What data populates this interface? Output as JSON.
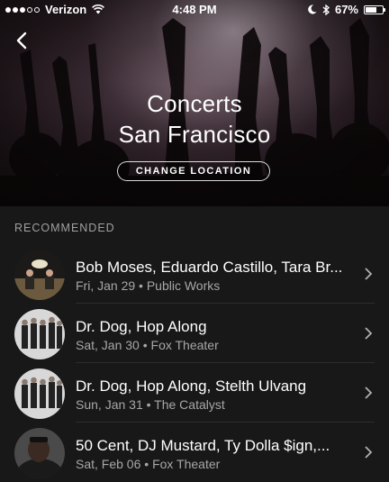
{
  "status_bar": {
    "carrier": "Verizon",
    "time": "4:48 PM",
    "battery": "67%",
    "battery_level": 0.67
  },
  "header": {
    "title_line1": "Concerts",
    "title_line2": "San Francisco",
    "change_location_label": "CHANGE LOCATION"
  },
  "section": {
    "label": "RECOMMENDED"
  },
  "concerts": [
    {
      "artists": "Bob Moses, Eduardo Castillo, Tara Br...",
      "date": "Fri, Jan 29",
      "venue": "Public Works"
    },
    {
      "artists": "Dr. Dog, Hop Along",
      "date": "Sat, Jan 30",
      "venue": "Fox Theater"
    },
    {
      "artists": "Dr. Dog, Hop Along, Stelth Ulvang",
      "date": "Sun, Jan 31",
      "venue": "The Catalyst"
    },
    {
      "artists": "50 Cent, DJ Mustard, Ty Dolla $ign,...",
      "date": "Sat, Feb 06",
      "venue": "Fox Theater"
    }
  ],
  "separator": "•"
}
